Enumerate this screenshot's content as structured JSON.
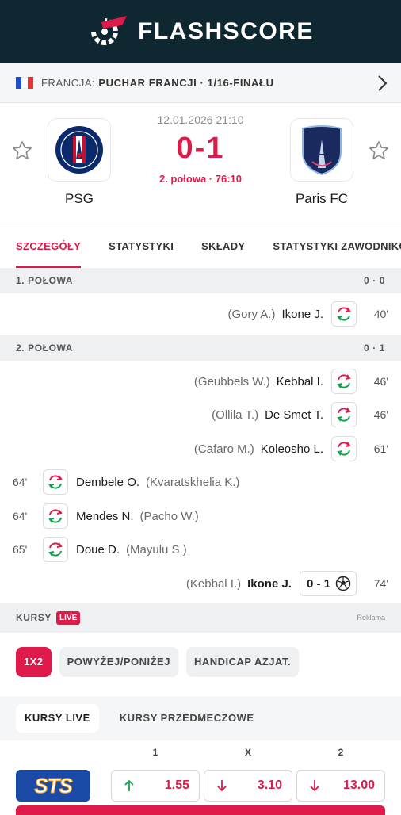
{
  "app": {
    "logo_text": "FLASHSCORE"
  },
  "league": {
    "country": "FRANCJA:",
    "competition": "PUCHAR FRANCJI · 1/16-FINAŁU"
  },
  "match": {
    "datetime": "12.01.2026 21:10",
    "score": "0-1",
    "status": "2. połowa · 76:10",
    "home": {
      "name": "PSG"
    },
    "away": {
      "name": "Paris FC"
    }
  },
  "tabs": [
    "SZCZEGÓŁY",
    "STATYSTYKI",
    "SKŁADY",
    "STATYSTYKI ZAWODNIKÓW"
  ],
  "halves": [
    {
      "label": "1. POŁOWA",
      "score": "0 · 0"
    },
    {
      "label": "2. POŁOWA",
      "score": "0 · 1"
    }
  ],
  "events": [
    {
      "assist": "(Gory A.)",
      "player": "Ikone J.",
      "minute": "40'"
    },
    {
      "assist": "(Geubbels W.)",
      "player": "Kebbal I.",
      "minute": "46'"
    },
    {
      "assist": "(Ollila T.)",
      "player": "De Smet T.",
      "minute": "46'"
    },
    {
      "assist": "(Cafaro M.)",
      "player": "Koleosho L.",
      "minute": "61'"
    },
    {
      "minute": "64'",
      "player": "Dembele O.",
      "assist": "(Kvaratskhelia K.)"
    },
    {
      "minute": "64'",
      "player": "Mendes N.",
      "assist": "(Pacho W.)"
    },
    {
      "minute": "65'",
      "player": "Doue D.",
      "assist": "(Mayulu S.)"
    },
    {
      "assist": "(Kebbal I.)",
      "player": "Ikone J.",
      "score": "0 - 1",
      "minute": "74'"
    }
  ],
  "odds": {
    "title": "KURSY",
    "live_badge": "LIVE",
    "ad_label": "Reklama",
    "filters": [
      "1X2",
      "POWYŻEJ/PONIŻEJ",
      "HANDICAP AZJAT."
    ],
    "subtabs": [
      "KURSY LIVE",
      "KURSY PRZEDMECZOWE"
    ],
    "columns": [
      "1",
      "X",
      "2"
    ],
    "bookmaker": "STS",
    "values": [
      {
        "value": "1.55",
        "trend": "up"
      },
      {
        "value": "3.10",
        "trend": "down"
      },
      {
        "value": "13.00",
        "trend": "down"
      }
    ]
  },
  "colors": {
    "accent": "#dd1a4a",
    "header": "#0f2730",
    "up": "#0aa34a",
    "down": "#dd1a4a"
  }
}
